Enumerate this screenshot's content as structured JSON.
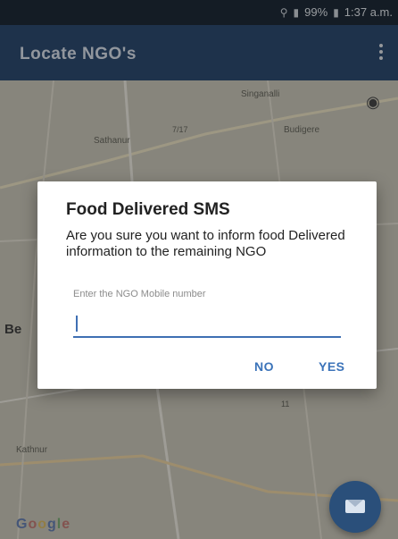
{
  "status": {
    "battery": "99%",
    "time": "1:37 a.m."
  },
  "appbar": {
    "title": "Locate NGO's",
    "more_icon": "more-vert-icon"
  },
  "map": {
    "places": [
      "Singanalli",
      "Sathanur",
      "Budigere",
      "Be",
      "Kathnur"
    ],
    "attribution": [
      "G",
      "o",
      "o",
      "g",
      "l",
      "e"
    ],
    "road_labels": [
      "7/17",
      "11"
    ]
  },
  "dialog": {
    "title": "Food Delivered SMS",
    "message": "Are you sure you want to inform food Delivered information to the remaining NGO",
    "input_label": "Enter the NGO Mobile number",
    "input_value": "",
    "no_label": "NO",
    "yes_label": "YES"
  },
  "fab": {
    "icon": "email-icon"
  },
  "colors": {
    "appbar": "#2f4d73",
    "accent": "#3b73b9",
    "fab": "#2a4f7a"
  }
}
